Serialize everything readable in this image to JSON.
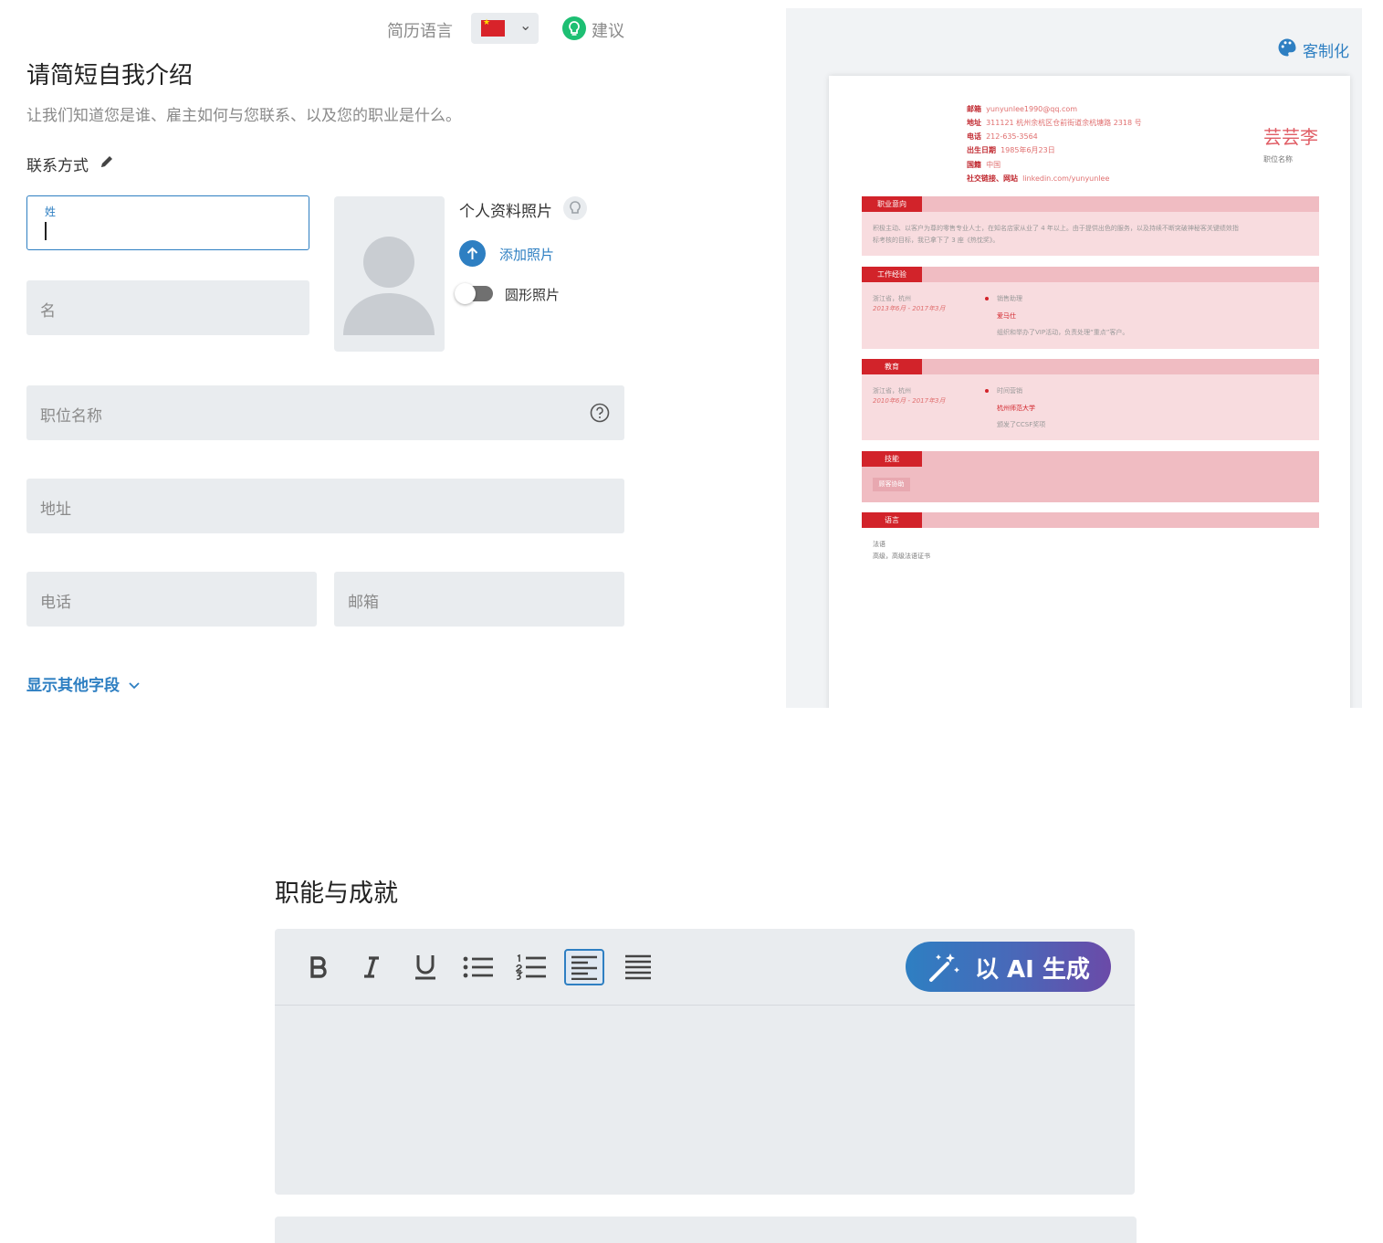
{
  "header": {
    "resume_language_label": "简历语言",
    "language_flag": "chinese-flag-icon",
    "tips_label": "建议"
  },
  "intro": {
    "title": "请简短自我介绍",
    "subtitle": "让我们知道您是谁、雇主如何与您联系、以及您的职业是什么。",
    "contact_label": "联系方式"
  },
  "form": {
    "last_name": {
      "label": "姓",
      "value": ""
    },
    "first_name_placeholder": "名",
    "photo": {
      "label": "个人资料照片",
      "add_label": "添加照片",
      "round_label": "圆形照片",
      "round_enabled": false
    },
    "job_title_placeholder": "职位名称",
    "address_placeholder": "地址",
    "phone_placeholder": "电话",
    "email_placeholder": "邮箱",
    "more_fields_label": "显示其他字段"
  },
  "preview": {
    "customize_label": "客制化",
    "name": "芸芸李",
    "job_title": "职位名称",
    "contact": [
      {
        "key": "邮箱",
        "value": "yunyunlee1990@qq.com"
      },
      {
        "key": "地址",
        "value": "311121 杭州余杭区仓前街道余杭塘路 2318 号"
      },
      {
        "key": "电话",
        "value": "212-635-3564"
      },
      {
        "key": "出生日期",
        "value": "1985年6月23日"
      },
      {
        "key": "国籍",
        "value": "中国"
      },
      {
        "key": "社交链接、网站",
        "value": "linkedin.com/yunyunlee"
      }
    ],
    "sections": {
      "objective": {
        "title": "职业意向",
        "text1": "积极主动、以客户为尊的零售专业人士，在知名店家从业了 4 年以上。由于提供出色的服务，以及持续不断突破神秘客关键绩效指",
        "text2": "标考核的目标，我已拿下了 3 座《热忱奖》。"
      },
      "experience": {
        "title": "工作经验",
        "location": "浙江省，杭州",
        "dates": "2013年6月 - 2017年3月",
        "role": "销售助理",
        "company": "爱马仕",
        "desc": "组织和举办了VIP活动，负责处理“重点”客户。"
      },
      "education": {
        "title": "教育",
        "location": "浙江省，杭州",
        "dates": "2010年6月 - 2017年3月",
        "degree": "时间营销",
        "school": "杭州师范大学",
        "desc": "颁发了CCSF奖项"
      },
      "skills": {
        "title": "技能",
        "items": [
          "顾客协助"
        ]
      },
      "languages": {
        "title": "语言",
        "name": "法语",
        "level": "高级，高级法语证书"
      }
    }
  },
  "editor": {
    "section_title": "职能与成就",
    "ai_button_label": "以 AI 生成",
    "tools": [
      "bold",
      "italic",
      "underline",
      "bullet-list",
      "numbered-list",
      "align-left",
      "justify"
    ]
  }
}
